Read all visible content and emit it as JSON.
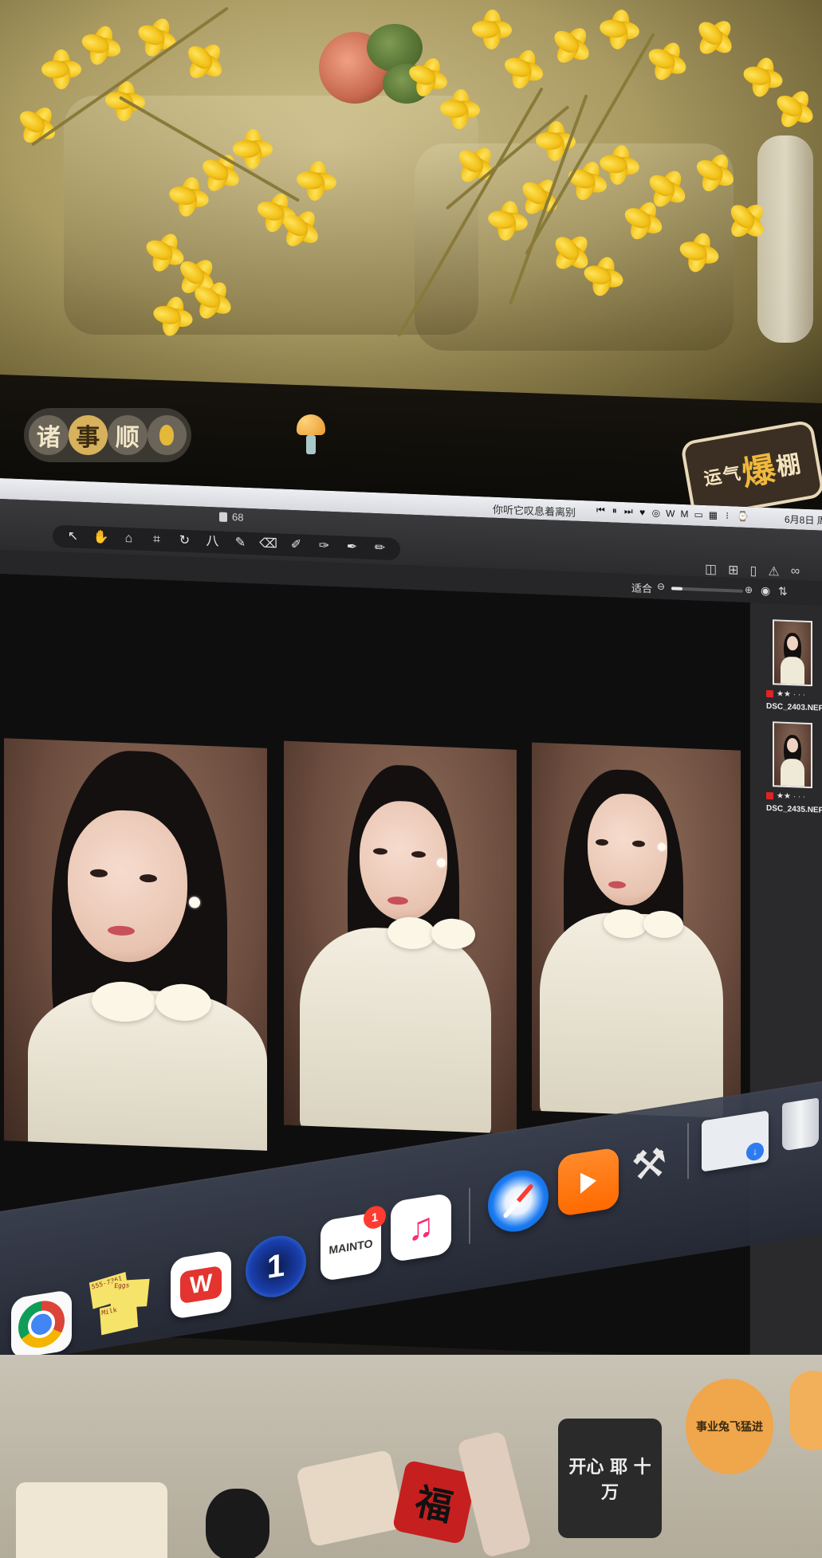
{
  "menubar": {
    "song": "你听它叹息着离别",
    "status_icons": [
      "⏮",
      "⏸",
      "⏭",
      "♥",
      "◎",
      "W",
      "M",
      "▭",
      "▦",
      "⁝",
      "⌚"
    ],
    "date": "6月8日 周"
  },
  "app": {
    "doc_count": "68",
    "tools": [
      {
        "name": "select-tool",
        "glyph": "↖"
      },
      {
        "name": "hand-tool",
        "glyph": "✋"
      },
      {
        "name": "stamp-tool",
        "glyph": "⌂"
      },
      {
        "name": "crop-tool",
        "glyph": "⌗"
      },
      {
        "name": "rotate-tool",
        "glyph": "↻"
      },
      {
        "name": "straighten-tool",
        "glyph": "八"
      },
      {
        "name": "brush-tool",
        "glyph": "✎"
      },
      {
        "name": "eraser-tool",
        "glyph": "⌫"
      },
      {
        "name": "pen-tool",
        "glyph": "✐"
      },
      {
        "name": "dropper-tool",
        "glyph": "✑"
      },
      {
        "name": "fill-tool",
        "glyph": "✒"
      },
      {
        "name": "pencil-tool",
        "glyph": "✏"
      }
    ],
    "view_icons": [
      "compare-view-icon",
      "grid-view-icon",
      "single-view-icon",
      "warning-icon",
      "glasses-icon"
    ],
    "fit_label": "适合",
    "zoom_level": 0.15
  },
  "filmstrip": [
    {
      "name": "DSC_2403.NEF",
      "rating": "★★ · · ·",
      "label_color": "#e02424"
    },
    {
      "name": "DSC_2435.NEF",
      "rating": "★★ · · ·",
      "label_color": "#e02424"
    }
  ],
  "stickers": {
    "top_left_chars": [
      "诸",
      "事",
      "顺"
    ],
    "top_right_chars": [
      "运气",
      "爆",
      "棚"
    ],
    "bottom": [
      {
        "text": "事业兔飞猛进"
      },
      {
        "text": "开心 耶 十 万"
      },
      {
        "text": "福"
      }
    ]
  },
  "dock": {
    "apps": [
      {
        "name": "chrome",
        "label": ""
      },
      {
        "name": "stickies",
        "label": "",
        "notes": [
          "555-7361",
          "Eggs",
          "Milk"
        ]
      },
      {
        "name": "wps",
        "label": "W"
      },
      {
        "name": "1password",
        "label": "1"
      },
      {
        "name": "mainto",
        "label": "MAINTO",
        "badge": "1"
      },
      {
        "name": "music",
        "label": "♫"
      },
      {
        "name": "safari",
        "label": ""
      },
      {
        "name": "infuse",
        "label": ""
      },
      {
        "name": "compass",
        "label": ""
      },
      {
        "name": "downloads-folder",
        "label": ""
      },
      {
        "name": "trash",
        "label": ""
      }
    ]
  },
  "colors": {
    "accent": "#ff9a3c",
    "label_red": "#e02424",
    "badge_red": "#ff3b30"
  }
}
